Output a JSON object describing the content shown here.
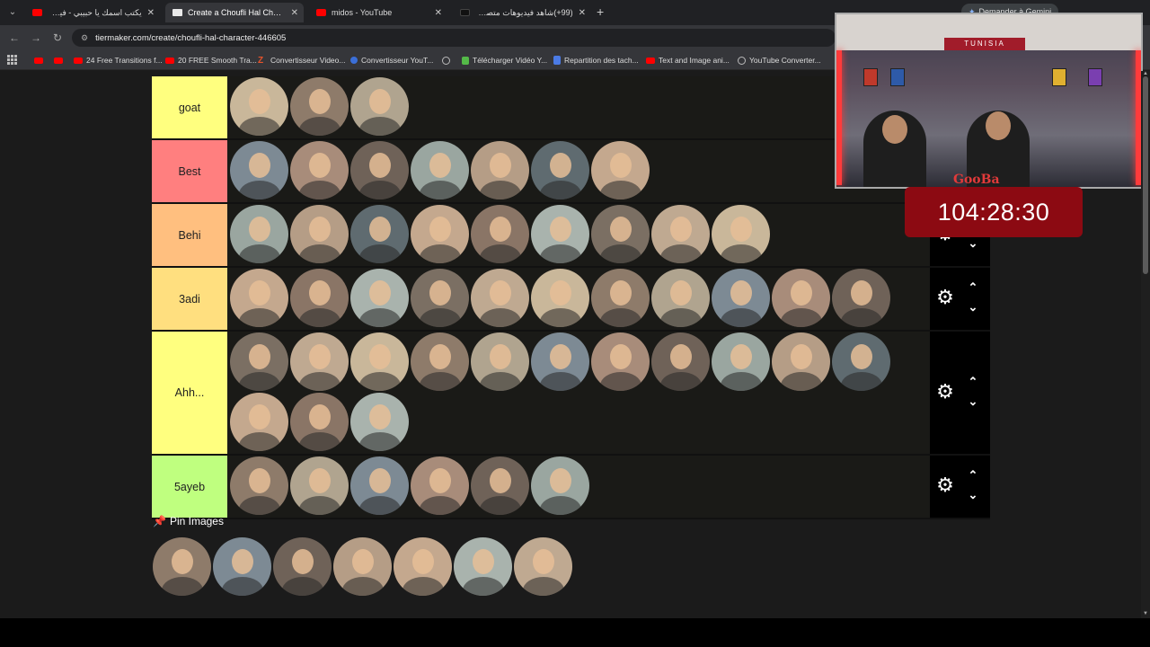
{
  "browser": {
    "tabs": [
      {
        "title": "يكتب اسمك يا حبيبي - فيروز | be",
        "favicon": "youtube-icon",
        "active": false
      },
      {
        "title": "Create a Choufli Hal Character Tier List",
        "favicon": "tiermaker-icon",
        "active": true
      },
      {
        "title": "midos - YouTube",
        "favicon": "youtube-icon",
        "active": false
      },
      {
        "title": "(99+)شاهد فيديوهات متصدرة | ...",
        "favicon": "tiktok-icon",
        "active": false
      }
    ],
    "new_tab": "+",
    "gemini_button": "Demander à Gemini",
    "url": "tiermaker.com/create/choufli-hal-character-446605",
    "bookmarks": [
      {
        "label": "",
        "icon": "youtube-icon"
      },
      {
        "label": "",
        "icon": "youtube-icon"
      },
      {
        "label": "24 Free Transitions f...",
        "icon": "youtube-icon"
      },
      {
        "label": "20 FREE Smooth Tra...",
        "icon": "youtube-icon"
      },
      {
        "label": "Convertisseur Video...",
        "icon": "z-icon"
      },
      {
        "label": "Convertisseur YouT...",
        "icon": "converter-icon"
      },
      {
        "label": "",
        "icon": "globe-icon"
      },
      {
        "label": "Télécharger Vidéo Y...",
        "icon": "download-icon"
      },
      {
        "label": "Repartition des tach...",
        "icon": "docs-icon"
      },
      {
        "label": "Text and Image ani...",
        "icon": "youtube-icon"
      },
      {
        "label": "YouTube Converter...",
        "icon": "globe-icon"
      }
    ]
  },
  "tiers": [
    {
      "label": "goat",
      "color": "#ffff7f",
      "count": 3
    },
    {
      "label": "Best",
      "color": "#ff7f7f",
      "count": 7
    },
    {
      "label": "Behi",
      "color": "#ffbf7f",
      "count": 9
    },
    {
      "label": "3adi",
      "color": "#ffdf7f",
      "count": 11
    },
    {
      "label": "Ahh...",
      "color": "#ffff7f",
      "count": 14
    },
    {
      "label": "5ayeb",
      "color": "#bfff7f",
      "count": 6
    }
  ],
  "pin_images": {
    "title": "Pin Images",
    "count": 7
  },
  "overlay": {
    "timer": "104:28:30",
    "webcam_banner": "TUNISIA",
    "webcam_logo": "GooBa"
  },
  "colors": {
    "timer_bg": "#8c0a12",
    "page_bg": "#1b1b1b",
    "control_bg": "#000000"
  }
}
